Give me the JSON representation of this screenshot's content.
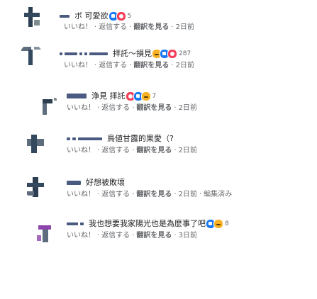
{
  "comments": [
    {
      "name": "",
      "text": "ボ 可愛欲",
      "reaction_count": "5",
      "actions": {
        "like": "いいね！",
        "reply": "返信する",
        "translate": "翻訳を見る",
        "time": "2日前",
        "edited": ""
      }
    },
    {
      "name": "",
      "text": "拝託〜損見",
      "reaction_count": "287",
      "actions": {
        "like": "いいね！",
        "reply": "返信する",
        "translate": "翻訳を見る",
        "time": "2日前",
        "edited": ""
      }
    },
    {
      "name": "",
      "text": "浄見 拝託",
      "reaction_count": "7",
      "actions": {
        "like": "いいね！",
        "reply": "返信する",
        "translate": "翻訳を見る",
        "time": "2日前",
        "edited": ""
      }
    },
    {
      "name": "",
      "text": "鳥値甘露的果愛（?",
      "reaction_count": "",
      "actions": {
        "like": "いいね！",
        "reply": "返信する",
        "translate": "翻訳を見る",
        "time": "2日前",
        "edited": ""
      }
    },
    {
      "name": "",
      "text": "好想被敗壞",
      "reaction_count": "",
      "actions": {
        "like": "いいね！",
        "reply": "返信する",
        "translate": "翻訳を見る",
        "time": "2日前",
        "edited": "編集済み"
      }
    },
    {
      "name": "",
      "text": "我也想要我家陽光也是為麼事了吧",
      "reaction_count": "8",
      "actions": {
        "like": "いいね！",
        "reply": "返信する",
        "translate": "翻訳を見る",
        "time": "3日前",
        "edited": ""
      }
    }
  ]
}
